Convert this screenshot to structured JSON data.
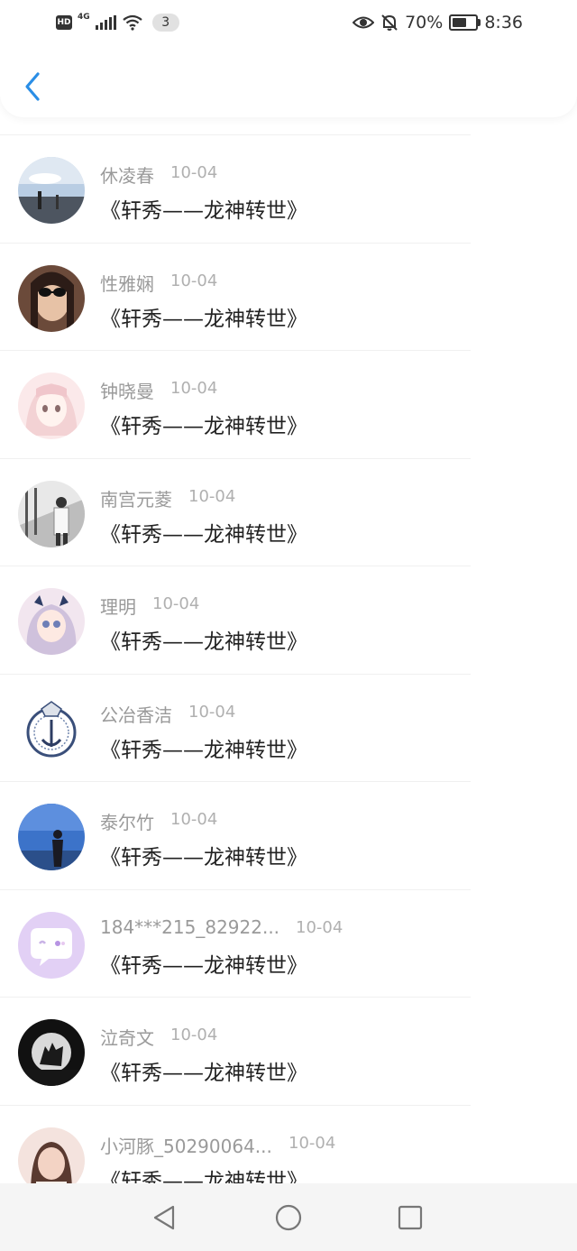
{
  "status_bar": {
    "hd": "HD",
    "network": "4G",
    "notifications": "3",
    "battery_percent": "70%",
    "battery_level": 0.7,
    "time": "8:36",
    "icons": [
      "hd-icon",
      "signal-icon",
      "wifi-icon",
      "eye-icon",
      "mute-bell-icon",
      "battery-icon"
    ]
  },
  "header": {
    "back_icon": "chevron-left-icon",
    "accent": "#2a8ee6"
  },
  "items": [
    {
      "name": "休凌春",
      "date": "10-04",
      "title": "《轩秀——龙神转世》",
      "avatar": "sky-scene"
    },
    {
      "name": "性雅娴",
      "date": "10-04",
      "title": "《轩秀——龙神转世》",
      "avatar": "woman-sunglasses"
    },
    {
      "name": "钟晓曼",
      "date": "10-04",
      "title": "《轩秀——龙神转世》",
      "avatar": "anime-pink"
    },
    {
      "name": "南宫元菱",
      "date": "10-04",
      "title": "《轩秀——龙神转世》",
      "avatar": "man-stairs"
    },
    {
      "name": "理明",
      "date": "10-04",
      "title": "《轩秀——龙神转世》",
      "avatar": "anime-girl"
    },
    {
      "name": "公冶香洁",
      "date": "10-04",
      "title": "《轩秀——龙神转世》",
      "avatar": "badge-emblem"
    },
    {
      "name": "泰尔竹",
      "date": "10-04",
      "title": "《轩秀——龙神转世》",
      "avatar": "blue-sky-person"
    },
    {
      "name": "184***215_82922...",
      "date": "10-04",
      "title": "《轩秀——龙神转世》",
      "avatar": "chat-bubble"
    },
    {
      "name": "泣奇文",
      "date": "10-04",
      "title": "《轩秀——龙神转世》",
      "avatar": "dark-wolf"
    },
    {
      "name": "小河豚_50290064...",
      "date": "10-04",
      "title": "《轩秀——龙神转世》",
      "avatar": "girl-portrait"
    }
  ],
  "nav_bar": {
    "back": "triangle-back-icon",
    "home": "circle-home-icon",
    "recents": "square-recents-icon"
  }
}
